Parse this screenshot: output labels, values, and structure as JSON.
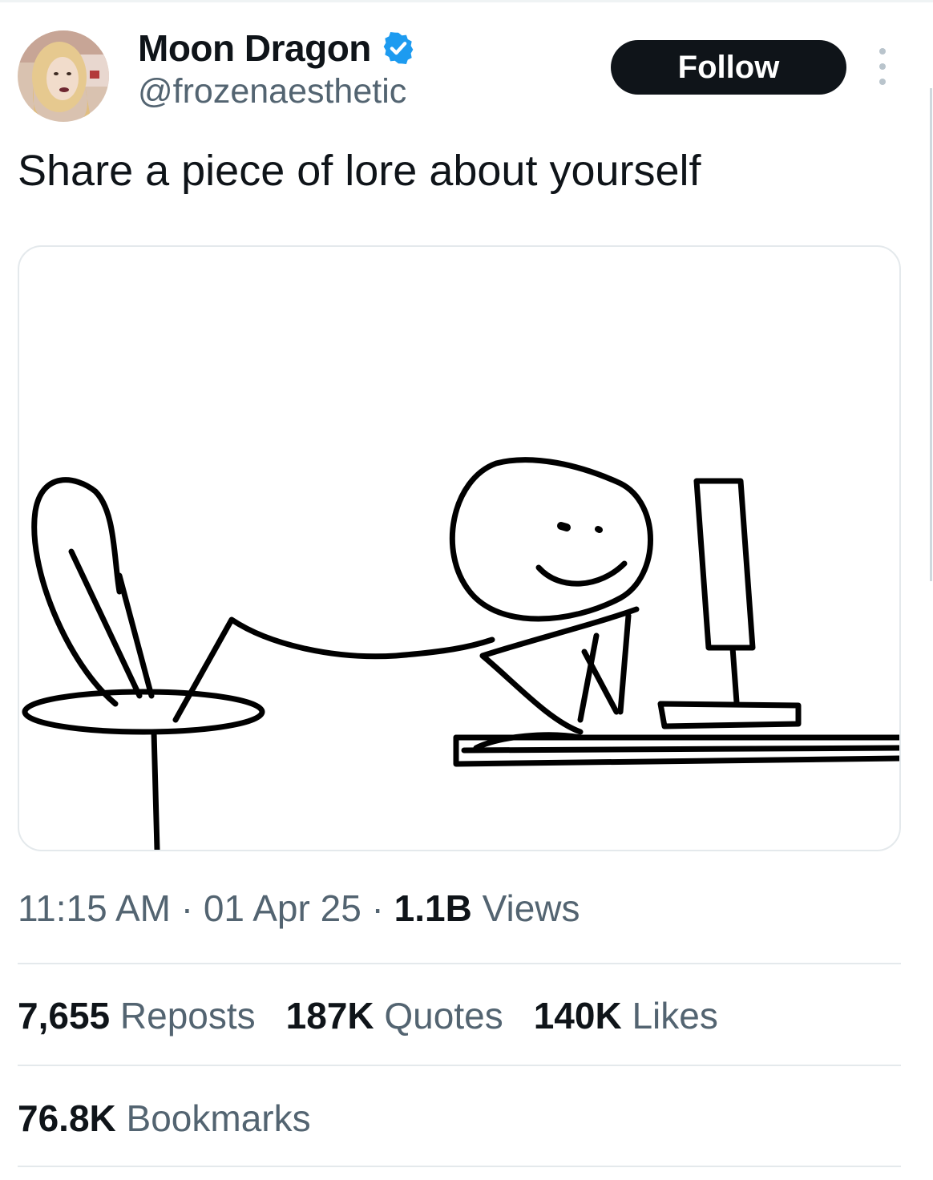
{
  "user": {
    "display_name": "Moon Dragon",
    "handle": "@frozenaesthetic",
    "verified": true
  },
  "actions": {
    "follow_label": "Follow"
  },
  "tweet": {
    "text": "Share a piece of lore about yourself",
    "time": "11:15 AM",
    "date": "01 Apr 25",
    "views_count": "1.1B",
    "views_label": "Views"
  },
  "stats": {
    "reposts_count": "7,655",
    "reposts_label": "Reposts",
    "quotes_count": "187K",
    "quotes_label": "Quotes",
    "likes_count": "140K",
    "likes_label": "Likes",
    "bookmarks_count": "76.8K",
    "bookmarks_label": "Bookmarks"
  },
  "colors": {
    "text_primary": "#0f1419",
    "text_secondary": "#536471",
    "verified_blue": "#1d9bf0",
    "follow_bg": "#0f1419",
    "divider": "#e4e9ec"
  },
  "icons": {
    "verified": "verified-badge-icon",
    "more": "more-dots-icon"
  }
}
